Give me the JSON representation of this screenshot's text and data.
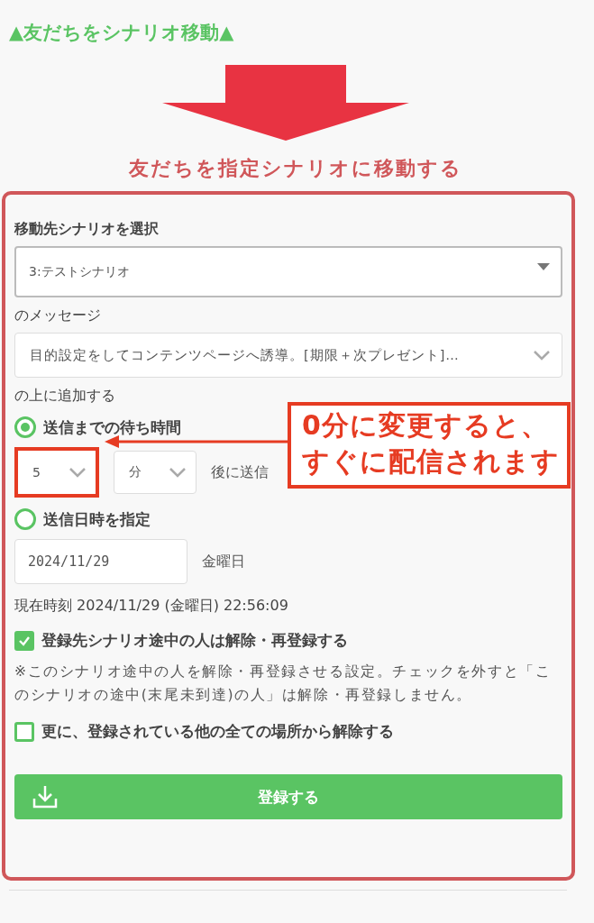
{
  "heading": "▲友だちをシナリオ移動▲",
  "title": "友だちを指定シナリオに移動する",
  "scenario": {
    "label": "移動先シナリオを選択",
    "value": "3:テストシナリオ"
  },
  "message": {
    "label": "のメッセージ",
    "value": "目的設定をしてコンテンツページへ誘導。[期限＋次プレゼント]…"
  },
  "position_label": "の上に追加する",
  "timing_options": [
    {
      "kind": "wait",
      "label": "送信までの待ち時間",
      "selected": true,
      "amount": "5",
      "unit": "分",
      "suffix": "後に送信"
    },
    {
      "kind": "datetime",
      "label": "送信日時を指定",
      "selected": false,
      "date": "2024/11/29",
      "weekday": "金曜日"
    }
  ],
  "current_time": "現在時刻 2024/11/29 (金曜日) 22:56:09",
  "options": [
    {
      "label": "登録先シナリオ途中の人は解除・再登録する",
      "checked": true,
      "note": "※このシナリオ途中の人を解除・再登録させる設定。チェックを外すと「このシナリオの途中(末尾未到達)の人」は解除・再登録しません。"
    },
    {
      "label": "更に、登録されている他の全ての場所から解除する",
      "checked": false
    }
  ],
  "submit": "登録する",
  "callout": [
    "0分に変更すると、",
    "すぐに配信されます"
  ]
}
